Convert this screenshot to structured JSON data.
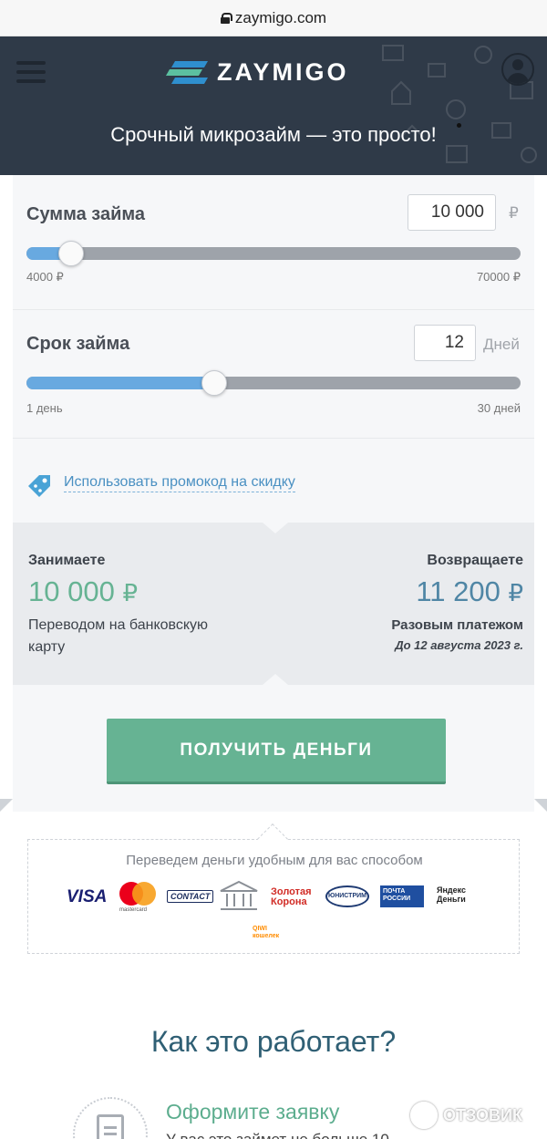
{
  "browser": {
    "url": "zaymigo.com"
  },
  "header": {
    "logo_text": "ZAYMIGO",
    "tagline": "Срочный микрозайм — это просто!",
    "colors": {
      "background": "#2f3a48",
      "logo_mark": [
        "#2f8fce",
        "#5cc0a0",
        "#2f8fce"
      ]
    }
  },
  "calculator": {
    "amount": {
      "title": "Сумма займа",
      "value": "10 000",
      "unit": "₽",
      "min_label": "4000 ₽",
      "max_label": "70000 ₽",
      "min": 4000,
      "max": 70000,
      "current": 10000
    },
    "term": {
      "title": "Срок займа",
      "value": "12",
      "unit": "Дней",
      "min_label": "1 день",
      "max_label": "30 дней",
      "min": 1,
      "max": 30,
      "current": 12
    },
    "promo_link": "Использовать промокод на скидку"
  },
  "summary": {
    "borrow_label": "Занимаете",
    "borrow_amount": "10 000",
    "currency": "₽",
    "borrow_note_1": "Переводом на банковскую",
    "borrow_note_2": "карту",
    "return_label": "Возвращаете",
    "return_amount": "11 200",
    "return_method": "Разовым платежом",
    "return_date": "До 12 августа 2023 г.",
    "colors": {
      "borrow": "#66b393",
      "return": "#4f86a5"
    }
  },
  "cta": {
    "label": "ПОЛУЧИТЬ ДЕНЬГИ",
    "color": "#66b393"
  },
  "payments": {
    "title": "Переведем деньги удобным для вас способом",
    "logos": {
      "visa": "VISA",
      "mastercard": "mastercard",
      "contact": "CONTACT",
      "zolotaya_1": "Золотая",
      "zolotaya_2": "Корона",
      "unistream": "ЮНИСТРИМ",
      "post_1": "ПОЧТА",
      "post_2": "РОССИИ",
      "yandex_1": "Яндекс",
      "yandex_2": "Деньги",
      "qiwi_1": "QIWI",
      "qiwi_2": "кошелек"
    }
  },
  "how": {
    "title": "Как это работает?",
    "step1_title": "Оформите заявку",
    "step1_text": "У вас это займет не больше 10"
  },
  "watermark": "ОТЗОВИК"
}
